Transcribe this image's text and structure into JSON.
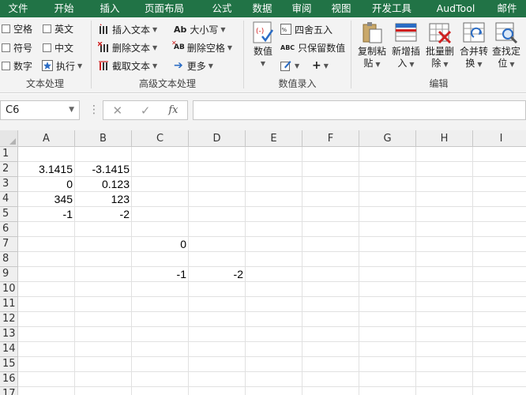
{
  "tabs": [
    "文件",
    "开始",
    "插入",
    "页面布局",
    "公式",
    "数据",
    "审阅",
    "视图",
    "开发工具",
    "AudTool",
    "邮件"
  ],
  "ribbon": {
    "text_processing": {
      "label": "文本处理",
      "options": [
        "空格",
        "英文",
        "符号",
        "中文",
        "数字"
      ],
      "execute": "执行"
    },
    "advanced_text": {
      "label": "高级文本处理",
      "insert_text": "插入文本",
      "delete_text": "删除文本",
      "extract_text": "截取文本",
      "case": "大小写",
      "delete_space": "删除空格",
      "more": "更多"
    },
    "number_entry": {
      "label": "数值录入",
      "value": "数值",
      "round": "四舍五入",
      "keep_numbers": "只保留数值",
      "plus": "+"
    },
    "edit": {
      "label": "编辑",
      "copy_paste": [
        "复制粘",
        "贴"
      ],
      "add_insert": [
        "新增插",
        "入"
      ],
      "batch_delete": [
        "批量删",
        "除"
      ],
      "merge_convert": [
        "合并转",
        "换"
      ],
      "find_locate": [
        "查找定",
        "位"
      ]
    }
  },
  "formula_bar": {
    "name_box": "C6",
    "formula": "",
    "cancel": "✕",
    "enter": "✓",
    "fx": "fx"
  },
  "sheet": {
    "columns": [
      "A",
      "B",
      "C",
      "D",
      "E",
      "F",
      "G",
      "H",
      "I"
    ],
    "rows": [
      "1",
      "2",
      "3",
      "4",
      "5",
      "6",
      "7",
      "8",
      "9",
      "10",
      "11",
      "12",
      "13",
      "14",
      "15",
      "16",
      "17"
    ],
    "cells": {
      "A2": "3.1415",
      "B2": "-3.1415",
      "A3": "0",
      "B3": "0.123",
      "A4": "345",
      "B4": "123",
      "A5": "-1",
      "B5": "-2",
      "C7": "0",
      "C9": "-1",
      "D9": "-2"
    },
    "selected": "C6"
  }
}
